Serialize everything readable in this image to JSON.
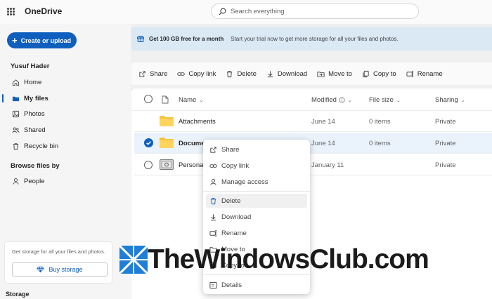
{
  "app": {
    "title": "OneDrive"
  },
  "search": {
    "placeholder": "Search everything"
  },
  "sidebar": {
    "create_label": "Create or upload",
    "user_name": "Yusuf Hader",
    "nav": [
      {
        "label": "Home",
        "icon": "home-icon"
      },
      {
        "label": "My files",
        "icon": "folder-icon",
        "active": true
      },
      {
        "label": "Photos",
        "icon": "photo-icon"
      },
      {
        "label": "Shared",
        "icon": "people-icon"
      },
      {
        "label": "Recycle bin",
        "icon": "trash-icon"
      }
    ],
    "browse_label": "Browse files by",
    "browse": [
      {
        "label": "People",
        "icon": "person-icon"
      }
    ],
    "storage_card": {
      "text": "Get storage for all your files and photos.",
      "button": "Buy storage"
    },
    "storage_label": "Storage"
  },
  "banner": {
    "title": "Get 100 GB free for a month",
    "text": "Start your trial now to get more storage for all your files and photos."
  },
  "commands": [
    "Share",
    "Copy link",
    "Delete",
    "Download",
    "Move to",
    "Copy to",
    "Rename"
  ],
  "table": {
    "columns": {
      "name": "Name",
      "modified": "Modified",
      "size": "File size",
      "sharing": "Sharing"
    },
    "rows": [
      {
        "name": "Attachments",
        "modified": "June 14",
        "size": "0 items",
        "sharing": "Private",
        "selected": false
      },
      {
        "name": "Documer",
        "modified": "June 14",
        "size": "0 items",
        "sharing": "Private",
        "selected": true
      },
      {
        "name": "Personal",
        "modified": "January 11",
        "size": "",
        "sharing": "Private",
        "selected": false
      }
    ]
  },
  "context_menu": {
    "items": [
      "Share",
      "Copy link",
      "Manage access",
      "Delete",
      "Download",
      "Rename",
      "Move to",
      "Copy to",
      "Details"
    ],
    "highlighted": "Delete"
  },
  "watermark": {
    "text": "TheWindowsClub.com"
  },
  "colors": {
    "accent": "#0f5fbf",
    "banner_bg": "#dbe9f5",
    "folder": "#f5c342",
    "selected_row": "#eaf2fb"
  }
}
